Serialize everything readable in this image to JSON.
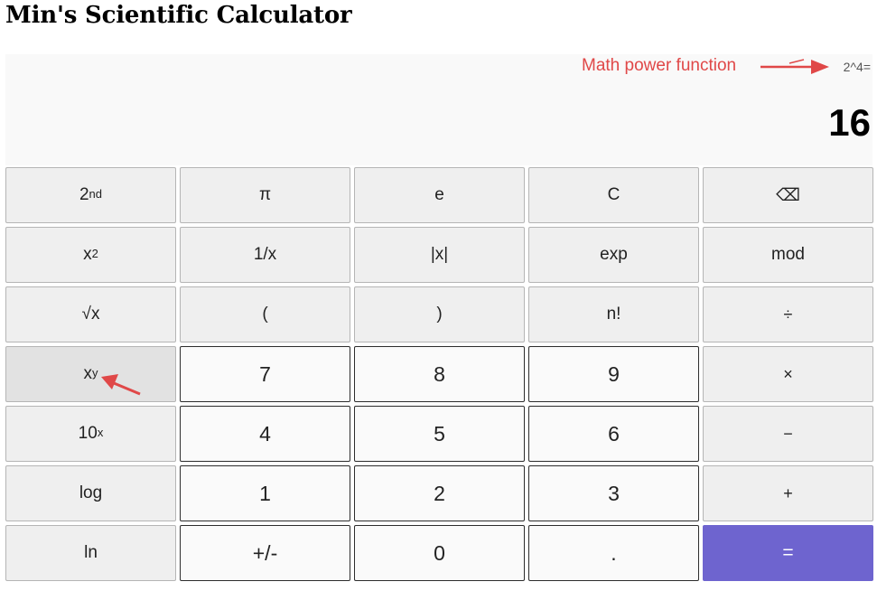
{
  "page": {
    "title": "Min's Scientific Calculator"
  },
  "display": {
    "expression": "2^4=",
    "result": "16"
  },
  "annotations": {
    "power_note": "Math power function",
    "arrow_color": "#e04848"
  },
  "colors": {
    "equals_button": "#6e64cf"
  },
  "keys": {
    "second": {
      "base": "2",
      "sup": "nd"
    },
    "pi": "π",
    "e": "e",
    "clear": "C",
    "backspace": "⌫",
    "square": {
      "base": "x",
      "sup": "2"
    },
    "reciprocal": "1/x",
    "abs": "|x|",
    "exp": "exp",
    "mod": "mod",
    "sqrt": "√x",
    "open_paren": "(",
    "close_paren": ")",
    "factorial": "n!",
    "divide": "÷",
    "power": {
      "base": "x",
      "sup": "y"
    },
    "seven": "7",
    "eight": "8",
    "nine": "9",
    "multiply": "×",
    "ten_power": {
      "base": "10",
      "sup": "x"
    },
    "four": "4",
    "five": "5",
    "six": "6",
    "minus": "−",
    "log": "log",
    "one": "1",
    "two": "2",
    "three": "3",
    "plus": "+",
    "ln": "ln",
    "negate": "+/-",
    "zero": "0",
    "decimal": ".",
    "equals": "="
  }
}
